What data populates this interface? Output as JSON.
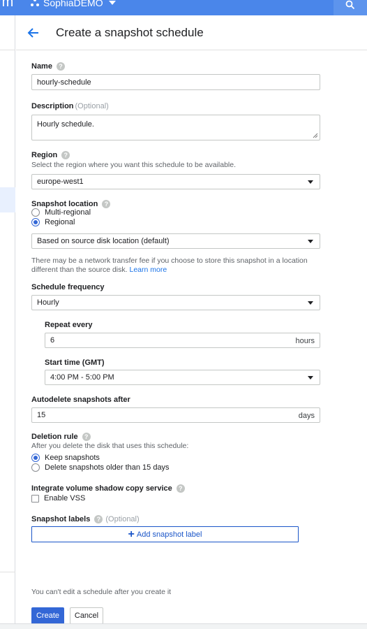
{
  "topbar": {
    "brand": "rm",
    "project": "SophiaDEMO"
  },
  "header": {
    "title": "Create a snapshot schedule"
  },
  "name": {
    "label": "Name",
    "value": "hourly-schedule"
  },
  "description": {
    "label": "Description",
    "optional": "(Optional)",
    "value": "Hourly schedule."
  },
  "region": {
    "label": "Region",
    "hint": "Select the region where you want this schedule to be available.",
    "value": "europe-west1"
  },
  "snapshot_location": {
    "label": "Snapshot location",
    "options": [
      "Multi-regional",
      "Regional"
    ],
    "selected": "Regional",
    "select_value": "Based on source disk location (default)",
    "note": "There may be a network transfer fee if you choose to store this snapshot in a location different than the source disk.",
    "learn_more": "Learn more"
  },
  "schedule_frequency": {
    "label": "Schedule frequency",
    "value": "Hourly"
  },
  "repeat_every": {
    "label": "Repeat every",
    "value": "6",
    "unit": "hours"
  },
  "start_time": {
    "label": "Start time (GMT)",
    "value": "4:00 PM - 5:00 PM"
  },
  "autodelete": {
    "label": "Autodelete snapshots after",
    "value": "15",
    "unit": "days"
  },
  "deletion_rule": {
    "label": "Deletion rule",
    "hint": "After you delete the disk that uses this schedule:",
    "options": [
      "Keep snapshots",
      "Delete snapshots older than 15 days"
    ],
    "selected": "Keep snapshots"
  },
  "vss": {
    "label": "Integrate volume shadow copy service",
    "checkbox_label": "Enable VSS",
    "checked": false
  },
  "labels": {
    "label": "Snapshot labels",
    "optional": "(Optional)",
    "add_label": "Add snapshot label"
  },
  "footer": {
    "message": "You can't edit a schedule after you create it",
    "create": "Create",
    "cancel": "Cancel"
  },
  "colors": {
    "accent": "#3367d6",
    "topbar": "#4a86ea",
    "link": "#1a73e8"
  }
}
